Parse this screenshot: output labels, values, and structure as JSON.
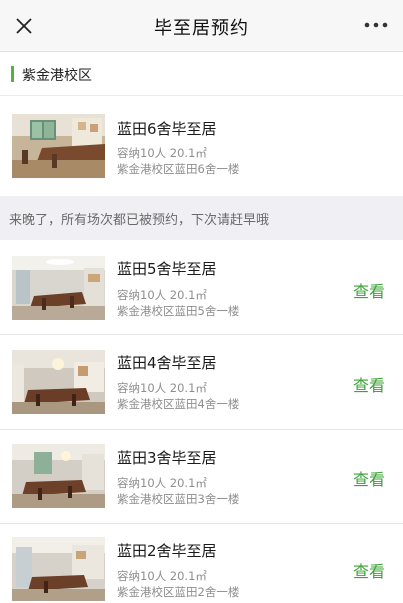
{
  "header": {
    "title": "毕至居预约",
    "close_icon": "close-icon",
    "more_icon": "more-icon"
  },
  "campus": {
    "label": "紫金港校区",
    "accent_color": "#52b33f"
  },
  "featured": {
    "name": "蓝田6舍毕至居",
    "capacity": "容纳10人 20.1㎡",
    "address": "紫金港校区蓝田6舍一楼"
  },
  "notice": "来晚了，所有场次都已被预约，下次请赶早哦",
  "rooms": [
    {
      "name": "蓝田5舍毕至居",
      "capacity": "容纳10人 20.1㎡",
      "address": "紫金港校区蓝田5舍一楼",
      "action": "查看"
    },
    {
      "name": "蓝田4舍毕至居",
      "capacity": "容纳10人 20.1㎡",
      "address": "紫金港校区蓝田4舍一楼",
      "action": "查看"
    },
    {
      "name": "蓝田3舍毕至居",
      "capacity": "容纳10人 20.1㎡",
      "address": "紫金港校区蓝田3舍一楼",
      "action": "查看"
    },
    {
      "name": "蓝田2舍毕至居",
      "capacity": "容纳10人 20.1㎡",
      "address": "紫金港校区蓝田2舍一楼",
      "action": "查看"
    }
  ],
  "action_color": "#3aa435"
}
